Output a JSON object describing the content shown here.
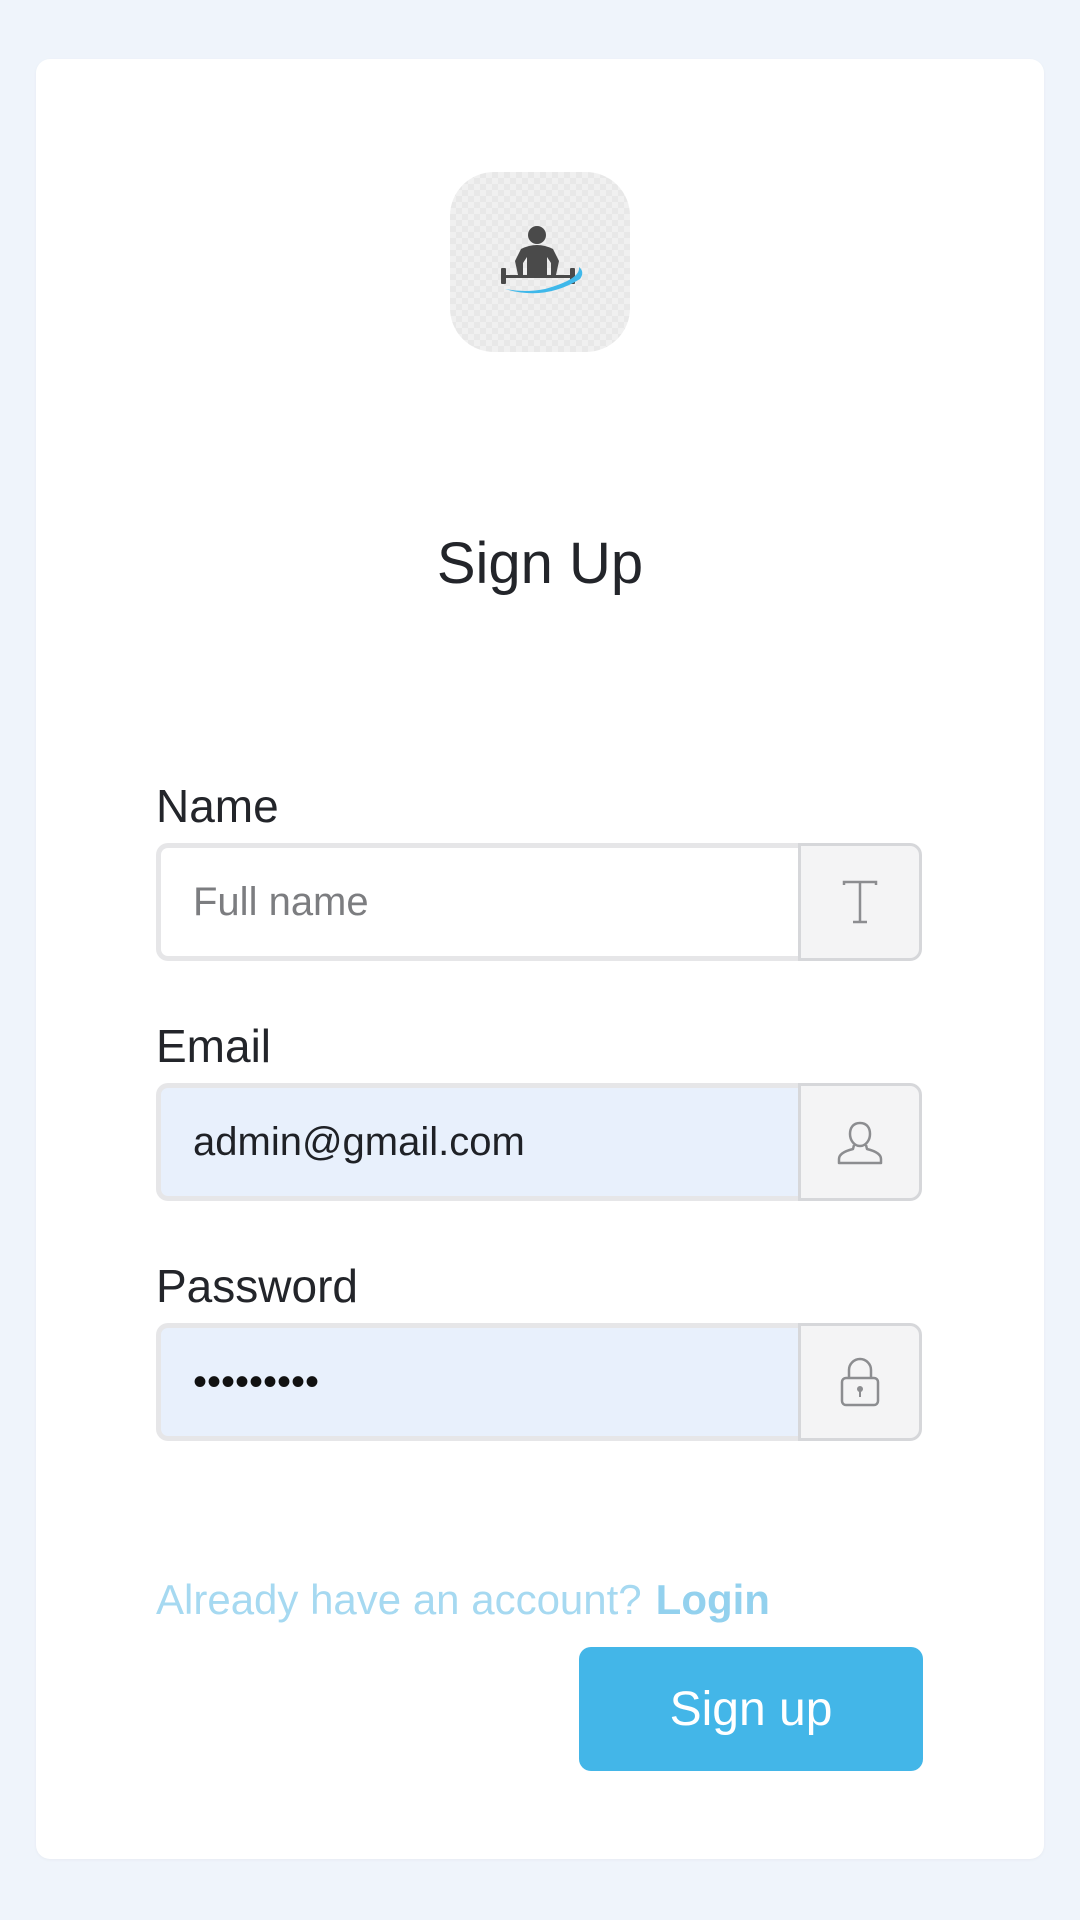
{
  "page": {
    "title": "Sign Up"
  },
  "form": {
    "name": {
      "label": "Name",
      "placeholder": "Full name",
      "value": "",
      "icon": "text-icon"
    },
    "email": {
      "label": "Email",
      "value": "admin@gmail.com",
      "icon": "user-icon"
    },
    "password": {
      "label": "Password",
      "masked_value": "•••••••••",
      "icon": "lock-icon"
    }
  },
  "footer": {
    "prompt": "Already have an account?",
    "login_link": "Login",
    "submit_label": "Sign up"
  },
  "colors": {
    "background": "#eff4fb",
    "accent": "#43b6e8",
    "link": "#93d1ee",
    "autofill": "#e8f0fc"
  }
}
